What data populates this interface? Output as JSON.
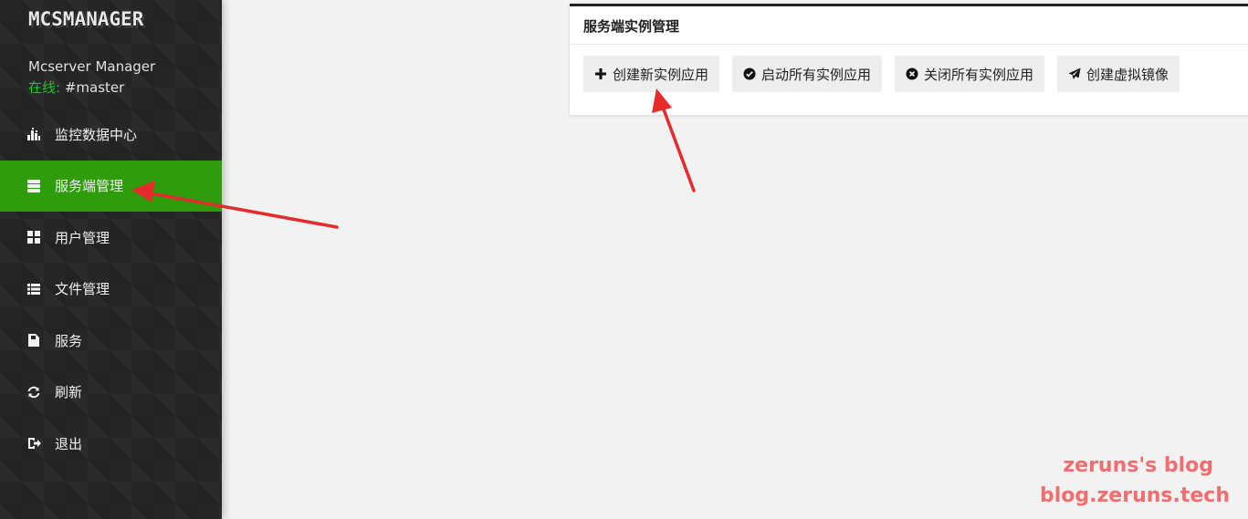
{
  "sidebar": {
    "logo": "MCSMANAGER",
    "app_name": "Mcserver Manager",
    "status_label": "在线:",
    "status_value": " #master",
    "items": [
      {
        "label": "监控数据中心",
        "icon": "bar-chart-icon",
        "active": false
      },
      {
        "label": "服务端管理",
        "icon": "server-icon",
        "active": true
      },
      {
        "label": "用户管理",
        "icon": "grid-icon",
        "active": false
      },
      {
        "label": "文件管理",
        "icon": "list-icon",
        "active": false
      },
      {
        "label": "服务",
        "icon": "service-icon",
        "active": false
      },
      {
        "label": "刷新",
        "icon": "refresh-icon",
        "active": false
      },
      {
        "label": "退出",
        "icon": "logout-icon",
        "active": false
      }
    ]
  },
  "panel": {
    "title": "服务端实例管理",
    "buttons": [
      {
        "label": "创建新实例应用",
        "icon": "plus-icon"
      },
      {
        "label": "启动所有实例应用",
        "icon": "check-circle-icon"
      },
      {
        "label": "关闭所有实例应用",
        "icon": "close-circle-icon"
      },
      {
        "label": "创建虚拟镜像",
        "icon": "send-icon"
      }
    ]
  },
  "watermark": {
    "line1": "zeruns's blog",
    "line2": "blog.zeruns.tech"
  },
  "colors": {
    "sidebar_bg": "#262626",
    "active_item": "#2e9c0b",
    "online_status": "#21c421",
    "annotation_arrow": "#e52b2b",
    "watermark": "#f26d6d"
  }
}
